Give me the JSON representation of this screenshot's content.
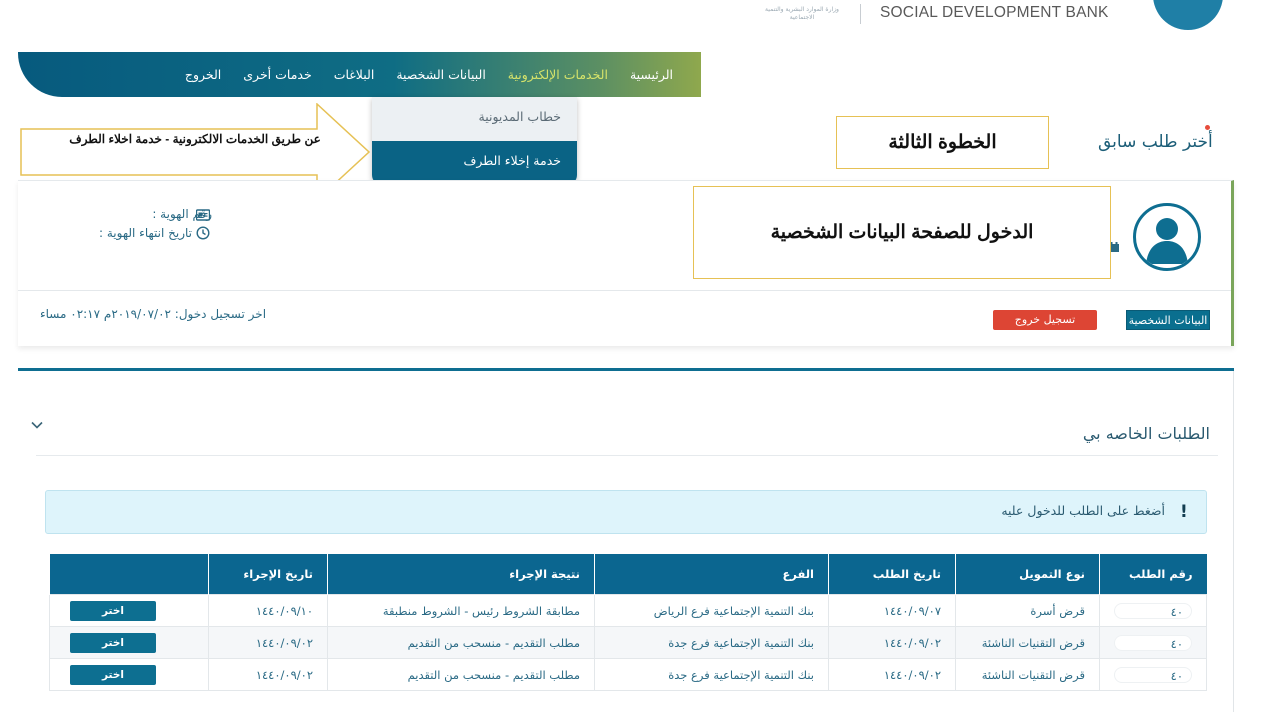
{
  "header": {
    "bank_name": "SOCIAL DEVELOPMENT BANK",
    "ministry_mark": "وزارة الموارد البشرية والتنمية الاجتماعية"
  },
  "nav": {
    "items": [
      {
        "label": "الرئيسية",
        "active": false
      },
      {
        "label": "الخدمات الإلكترونية",
        "active": true
      },
      {
        "label": "البيانات الشخصية",
        "active": false
      },
      {
        "label": "البلاغات",
        "active": false
      },
      {
        "label": "خدمات أخرى",
        "active": false
      },
      {
        "label": "الخروج",
        "active": false
      }
    ],
    "dropdown": [
      {
        "label": "خطاب المديونية"
      },
      {
        "label": "خدمة إخلاء الطرف"
      }
    ]
  },
  "annotations": {
    "arrow_text": "عن طريق الخدمات الالكترونية - خدمة اخلاء الطرف",
    "step_label": "الخطوة الثالثة",
    "profile_label": "الدخول للصفحة البيانات الشخصية"
  },
  "prev_request": "أختر طلب سابق",
  "profile": {
    "id_label": "رقم الهوية :",
    "id_expiry_label": "تاريخ انتهاء الهوية :",
    "personal_button": "البيانات الشخصية",
    "logout_button": "تسجيل خروج",
    "last_login": "اخر تسجيل دخول: ٢٠١٩/٠٧/٠٢م ٠٢:١٧ مساء"
  },
  "requests": {
    "title": "الطلبات الخاصه بي",
    "alert_icon": "!",
    "alert": "أضغط على الطلب للدخول عليه",
    "columns": [
      "رقم الطلب",
      "نوع التمويل",
      "تاريخ الطلب",
      "الفرع",
      "نتيجة الإجراء",
      "تاريخ الإجراء",
      ""
    ],
    "rows": [
      {
        "number": "٤٠",
        "type": "قرض أسرة",
        "date": "١٤٤٠/٠٩/٠٧",
        "branch": "بنك التنمية الإجتماعية فرع الرياض",
        "result": "مطابقة الشروط رئيس - الشروط منطبقة",
        "action_date": "١٤٤٠/٠٩/١٠",
        "button": "اختر"
      },
      {
        "number": "٤٠",
        "type": "قرض التقنيات الناشئة",
        "date": "١٤٤٠/٠٩/٠٢",
        "branch": "بنك التنمية الإجتماعية فرع جدة",
        "result": "مطلب التقديم - منسحب من التقديم",
        "action_date": "١٤٤٠/٠٩/٠٢",
        "button": "اختر"
      },
      {
        "number": "٤٠",
        "type": "قرض التقنيات الناشئة",
        "date": "١٤٤٠/٠٩/٠٢",
        "branch": "بنك التنمية الإجتماعية فرع جدة",
        "result": "مطلب التقديم - منسحب من التقديم",
        "action_date": "١٤٤٠/٠٩/٠٢",
        "button": "اختر"
      }
    ]
  },
  "colors": {
    "primary": "#0b6690",
    "nav_active": "#d6e36a",
    "logout": "#dd4534",
    "callout_border": "#e6c155"
  }
}
